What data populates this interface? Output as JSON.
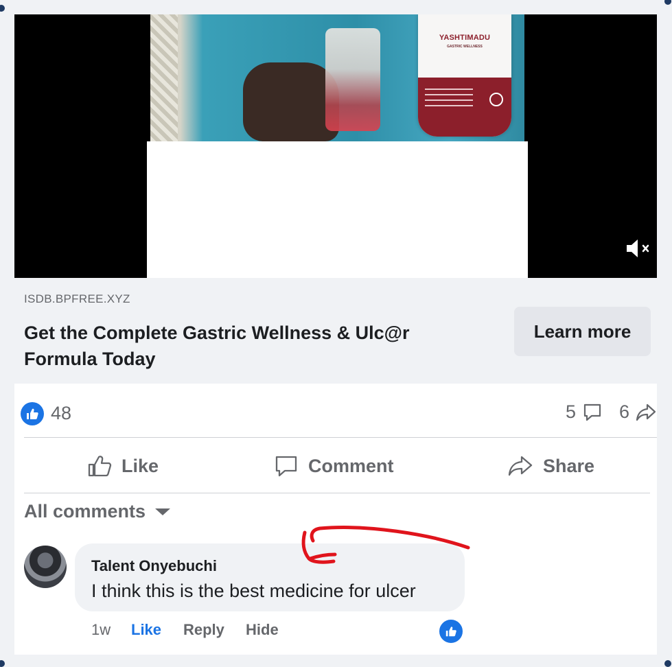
{
  "ad": {
    "domain": "ISDB.BPFREE.XYZ",
    "title": "Get the Complete Gastric Wellness & Ulc@r Formula Today",
    "cta_label": "Learn more",
    "product_label": "YASHTIMADU",
    "product_sublabel": "GASTRIC WELLNESS"
  },
  "stats": {
    "likes": "48",
    "comments": "5",
    "shares": "6"
  },
  "actions": {
    "like": "Like",
    "comment": "Comment",
    "share": "Share"
  },
  "comments_filter": "All comments",
  "comment": {
    "author": "Talent Onyebuchi",
    "text": "I think this is the best medicine for ulcer",
    "time": "1w",
    "like": "Like",
    "reply": "Reply",
    "hide": "Hide"
  },
  "colors": {
    "brand_blue": "#1b74e4",
    "annotation_red": "#e0141c",
    "product_red": "#8c1f2b"
  },
  "icons": [
    "mute-icon",
    "like-reaction-icon",
    "comment-icon",
    "share-icon",
    "thumbs-up-icon",
    "caret-down-icon"
  ]
}
